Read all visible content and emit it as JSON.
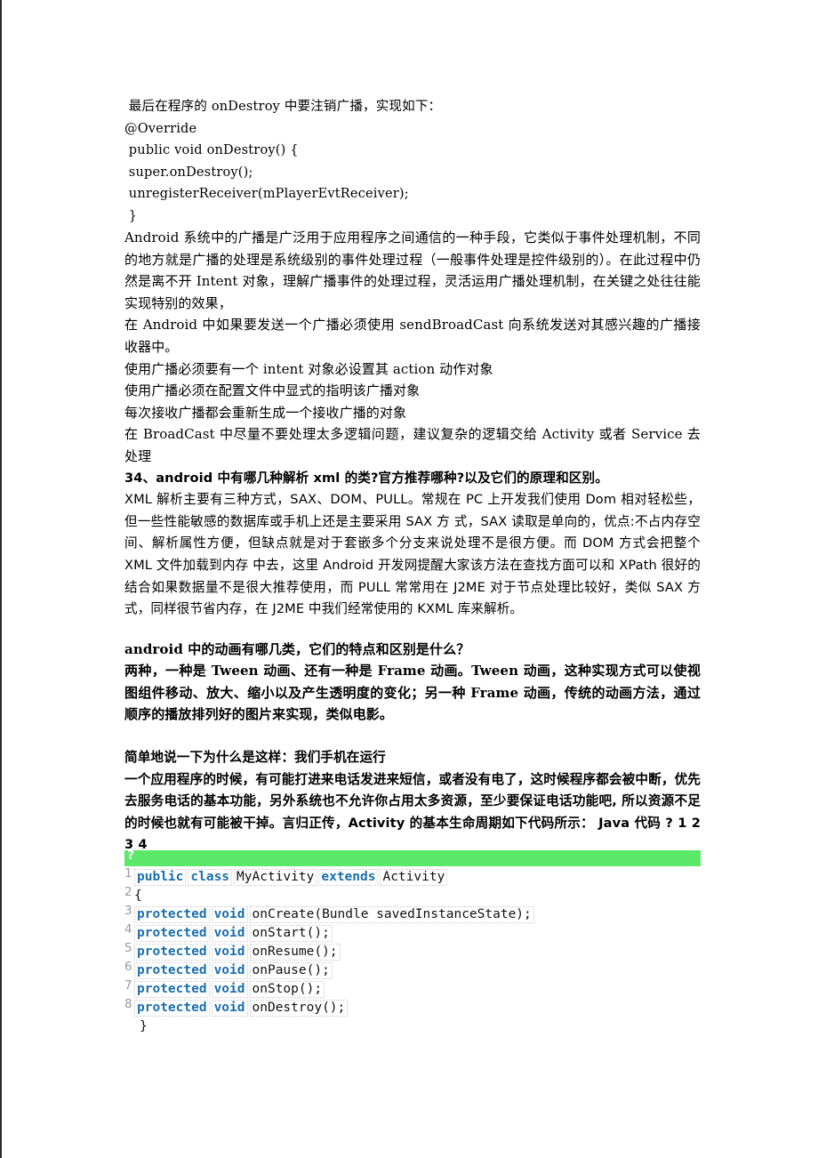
{
  "document": {
    "body_lines": [
      {
        "id": "l1",
        "style": "mono-indent",
        "text": " 最后在程序的 onDestroy 中要注销广播，实现如下："
      },
      {
        "id": "l2",
        "style": "mono",
        "text": "@Override"
      },
      {
        "id": "l3",
        "style": "mono-indent",
        "text": " public void onDestroy() {"
      },
      {
        "id": "l4",
        "style": "mono-indent",
        "text": " super.onDestroy();"
      },
      {
        "id": "l5",
        "style": "mono-indent",
        "text": " unregisterReceiver(mPlayerEvtReceiver);"
      },
      {
        "id": "l6",
        "style": "mono-indent",
        "text": " }"
      }
    ],
    "para_broadcast_1": " Android 系统中的广播是广泛用于应用程序之间通信的一种手段，它类似于事件处理机制，不同的地方就是广播的处理是系统级别的事件处理过程（一般事件处理是控件级别的）。在此过程中仍然是离不开 Intent 对象，理解广播事件的处理过程，灵活运用广播处理机制，在关键之处往往能实现特别的效果，",
    "para_broadcast_2": " 在 Android 中如果要发送一个广播必须使用 sendBroadCast 向系统发送对其感兴趣的广播接收器中。",
    "bullet_lines": [
      {
        "id": "b1",
        "text": " 使用广播必须要有一个 intent 对象必设置其 action 动作对象"
      },
      {
        "id": "b2",
        "text": " 使用广播必须在配置文件中显式的指明该广播对象"
      },
      {
        "id": "b3",
        "text": " 每次接收广播都会重新生成一个接收广播的对象"
      }
    ],
    "para_broadcast_3": " 在 BroadCast 中尽量不要处理太多逻辑问题，建议复杂的逻辑交给 Activity 或者 Service 去处理",
    "heading_34": "34、android 中有哪几种解析 xml 的类?官方推荐哪种?以及它们的原理和区别。",
    "para_xml": "XML 解析主要有三种方式，SAX、DOM、PULL。常规在 PC 上开发我们使用 Dom 相对轻松些，但一些性能敏感的数据库或手机上还是主要采用 SAX 方 式，SAX 读取是单向的，优点:不占内存空间、解析属性方便，但缺点就是对于套嵌多个分支来说处理不是很方便。而 DOM 方式会把整个 XML 文件加载到内存 中去，这里 Android 开发网提醒大家该方法在查找方面可以和 XPath 很好的结合如果数据量不是很大推荐使用，而 PULL 常常用在 J2ME 对于节点处理比较好，类似 SAX 方式，同样很节省内存，在 J2ME 中我们经常使用的 KXML 库来解析。",
    "heading_animation": "android 中的动画有哪几类，它们的特点和区别是什么？",
    "para_animation": "两种，一种是 Tween 动画、还有一种是 Frame 动画。Tween 动画，这种实现方式可以使视图组件移动、放大、缩小以及产生透明度的变化；另一种 Frame 动画，传统的动画方法，通过顺序的播放排列好的图片来实现，类似电影。",
    "heading_lifecycle": "简单地说一下为什么是这样：我们手机在运行",
    "para_lifecycle": "一个应用程序的时候，有可能打进来电话发进来短信，或者没有电了，这时候程序都会被中断，优先去服务电话的基本功能，另外系统也不允许你占用太多资源，至少要保证电话功能吧, 所以资源不足的时候也就有可能被干掉。言归正传，Activity 的基本生命周期如下代码所示： Java 代码 ? 1 2 3 4"
  },
  "code_block": {
    "toolbar": {
      "question_mark": "?",
      "bar_color": "#5ce96a"
    },
    "keyword_color": "#1a6fad",
    "lineno_color": "#9a9a9a",
    "lines": [
      {
        "number": "1",
        "tokens": [
          {
            "type": "kw",
            "text": "public"
          },
          {
            "type": "kw",
            "text": "class"
          },
          {
            "type": "tok",
            "text": "MyActivity"
          },
          {
            "type": "kw",
            "text": "extends"
          },
          {
            "type": "tok",
            "text": "Activity"
          }
        ]
      },
      {
        "number": "2",
        "brace": "{",
        "tokens": []
      },
      {
        "number": "3",
        "tokens": [
          {
            "type": "kw",
            "text": "protected"
          },
          {
            "type": "kw",
            "text": "void"
          },
          {
            "type": "tok",
            "text": "onCreate(Bundle savedInstanceState);"
          }
        ]
      },
      {
        "number": "4",
        "tokens": [
          {
            "type": "kw",
            "text": "protected"
          },
          {
            "type": "kw",
            "text": "void"
          },
          {
            "type": "tok",
            "text": "onStart();"
          }
        ]
      },
      {
        "number": "5",
        "tokens": [
          {
            "type": "kw",
            "text": "protected"
          },
          {
            "type": "kw",
            "text": "void"
          },
          {
            "type": "tok",
            "text": "onResume();"
          }
        ]
      },
      {
        "number": "6",
        "tokens": [
          {
            "type": "kw",
            "text": "protected"
          },
          {
            "type": "kw",
            "text": "void"
          },
          {
            "type": "tok",
            "text": "onPause();"
          }
        ]
      },
      {
        "number": "7",
        "tokens": [
          {
            "type": "kw",
            "text": "protected"
          },
          {
            "type": "kw",
            "text": "void"
          },
          {
            "type": "tok",
            "text": "onStop();"
          }
        ]
      },
      {
        "number": "8",
        "tokens": [
          {
            "type": "kw",
            "text": "protected"
          },
          {
            "type": "kw",
            "text": "void"
          },
          {
            "type": "tok",
            "text": "onDestroy();"
          }
        ]
      },
      {
        "number": "",
        "closing": "}",
        "tokens": []
      }
    ]
  }
}
